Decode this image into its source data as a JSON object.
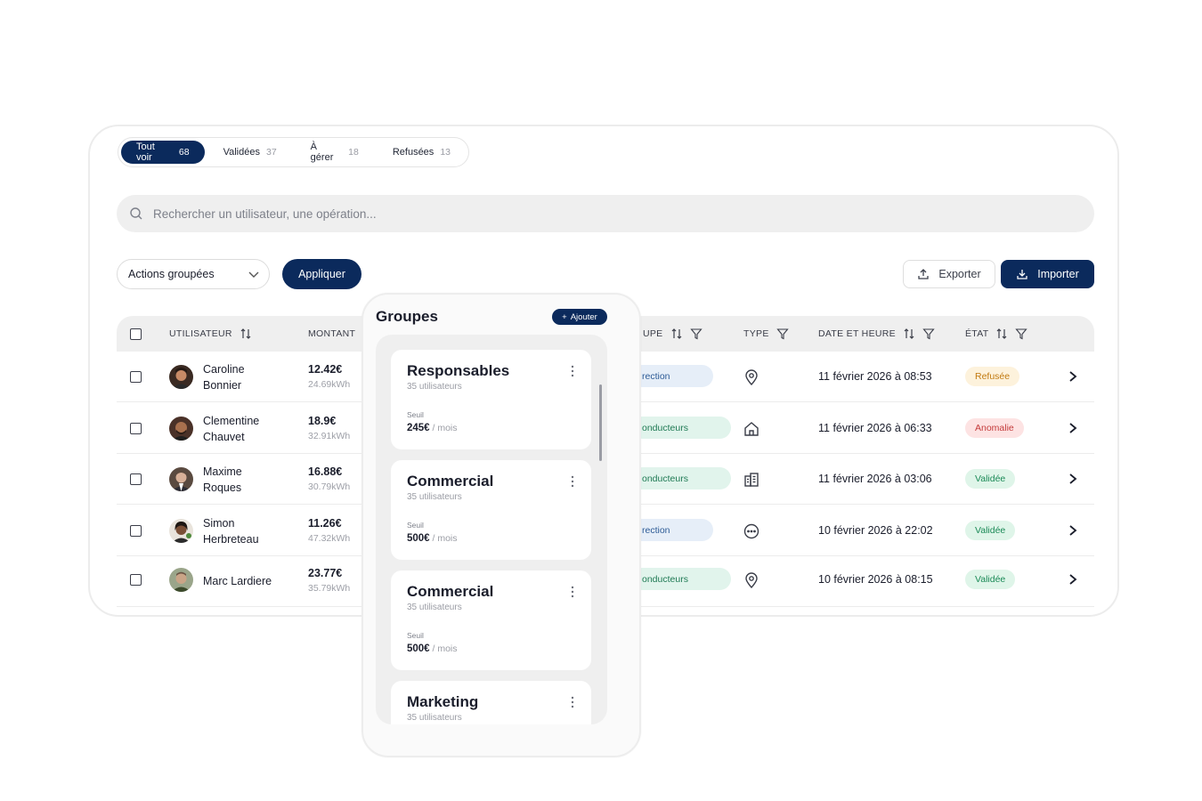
{
  "tabs": [
    {
      "label": "Tout voir",
      "count": "68"
    },
    {
      "label": "Validées",
      "count": "37"
    },
    {
      "label": "À gérer",
      "count": "18"
    },
    {
      "label": "Refusées",
      "count": "13"
    }
  ],
  "search": {
    "placeholder": "Rechercher un utilisateur, une opération..."
  },
  "toolbar": {
    "bulk_label": "Actions groupées",
    "apply_label": "Appliquer",
    "export_label": "Exporter",
    "import_label": "Importer"
  },
  "table": {
    "headers": {
      "user": "UTILISATEUR",
      "amount": "MONTANT",
      "group": "UPE",
      "type": "TYPE",
      "date": "DATE ET HEURE",
      "state": "ÉTAT"
    },
    "rows": [
      {
        "name": "Caroline Bonnier",
        "amount": "12.42€",
        "kwh": "24.69kWh",
        "group": "rection",
        "type_icon": "location-pin-icon",
        "date": "11 février 2026 à 08:53",
        "state": "Refusée"
      },
      {
        "name": "Clementine Chauvet",
        "amount": "18.9€",
        "kwh": "32.91kWh",
        "group": "onducteurs",
        "type_icon": "home-icon",
        "date": "11 février 2026 à 06:33",
        "state": "Anomalie"
      },
      {
        "name": "Maxime Roques",
        "amount": "16.88€",
        "kwh": "30.79kWh",
        "group": "onducteurs",
        "type_icon": "building-icon",
        "date": "11 février 2026 à 03:06",
        "state": "Validée"
      },
      {
        "name": "Simon Herbreteau",
        "amount": "11.26€",
        "kwh": "47.32kWh",
        "group": "rection",
        "type_icon": "more-circle-icon",
        "date": "10 février 2026 à 22:02",
        "state": "Validée"
      },
      {
        "name": "Marc Lardiere",
        "amount": "23.77€",
        "kwh": "35.79kWh",
        "group": "onducteurs",
        "type_icon": "location-pin-icon",
        "date": "10 février 2026 à 08:15",
        "state": "Validée"
      }
    ]
  },
  "groups_panel": {
    "title": "Groupes",
    "add_label": "Ajouter",
    "items": [
      {
        "name": "Responsables",
        "users": "35 utilisateurs",
        "seuil_label": "Seuil",
        "value": "245€",
        "period": " / mois"
      },
      {
        "name": "Commercial",
        "users": "35 utilisateurs",
        "seuil_label": "Seuil",
        "value": "500€",
        "period": " / mois"
      },
      {
        "name": "Commercial",
        "users": "35 utilisateurs",
        "seuil_label": "Seuil",
        "value": "500€",
        "period": " / mois"
      },
      {
        "name": "Marketing",
        "users": "35 utilisateurs",
        "seuil_label": "",
        "value": "",
        "period": ""
      }
    ]
  },
  "colors": {
    "primary": "#0b2a5c",
    "refused": "#c27a10",
    "anomaly": "#c43b3b",
    "validated": "#1b8a57"
  }
}
